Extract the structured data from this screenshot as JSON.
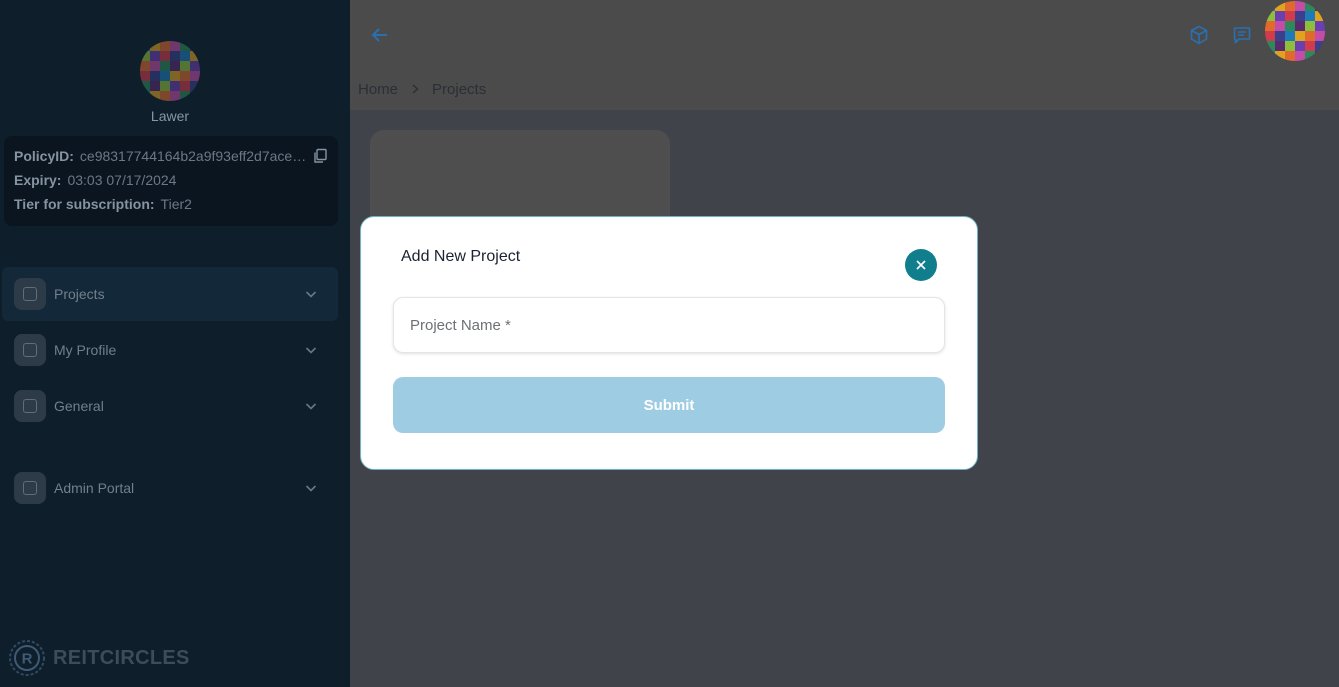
{
  "sidebar": {
    "user_name": "Lawer",
    "policy": {
      "policy_id_label": "PolicyID:",
      "policy_id_value": "ce98317744164b2a9f93eff2d7ace…",
      "expiry_label": "Expiry:",
      "expiry_value": "03:03 07/17/2024",
      "tier_label": "Tier for subscription:",
      "tier_value": "Tier2"
    },
    "nav_items": [
      {
        "label": "Projects",
        "active": true
      },
      {
        "label": "My Profile"
      },
      {
        "label": "General"
      },
      {
        "label": "Admin Portal"
      }
    ],
    "brand": "REITCIRCLES"
  },
  "main": {
    "breadcrumb": [
      "Home",
      "Projects"
    ],
    "top_icons": [
      "cube-icon",
      "chat-icon"
    ]
  },
  "modal": {
    "title": "Add New Project",
    "project_name_placeholder": "Project Name *",
    "project_name_value": "",
    "submit_label": "Submit"
  },
  "colors": {
    "sidebar_bg": "#0f1e2b",
    "accent_teal": "#117e8e",
    "submit_disabled": "#9ecce2",
    "modal_border": "#6fb4c6",
    "icon_blue": "#2a6fb0"
  }
}
